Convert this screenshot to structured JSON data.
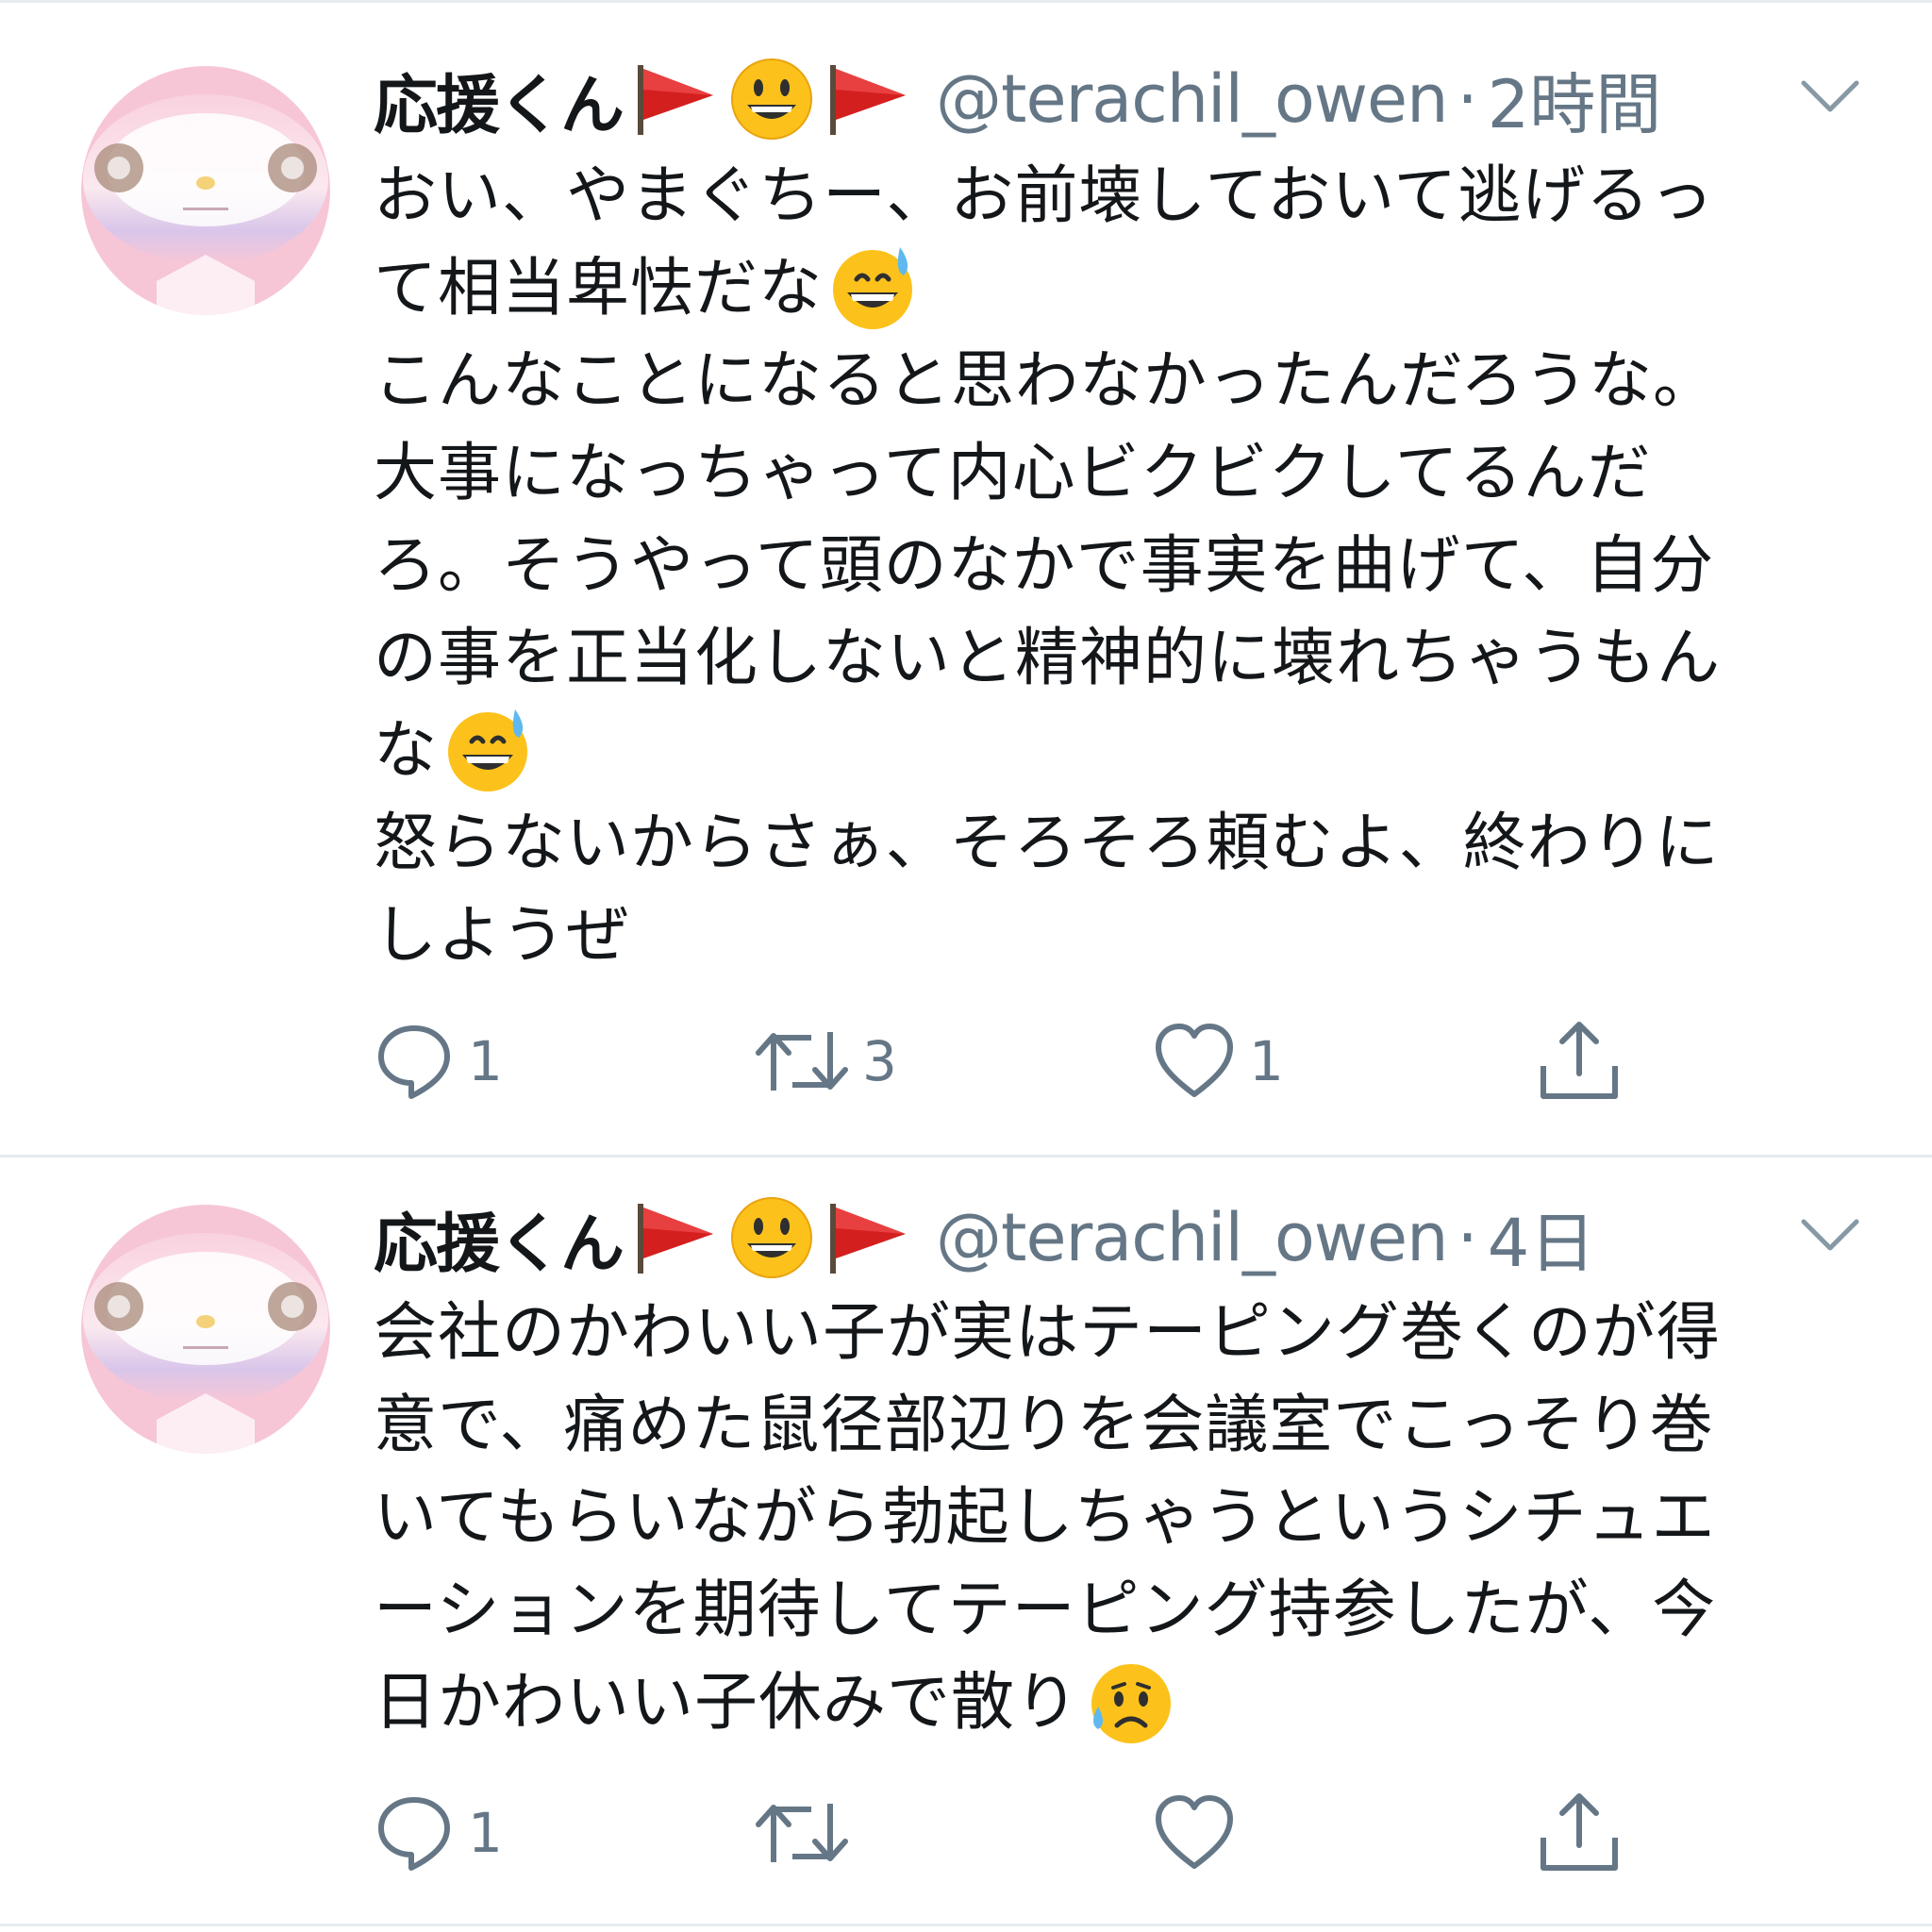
{
  "tweets": [
    {
      "author": {
        "display_name": "応援くん",
        "name_emojis": [
          "red-flag-icon",
          "grinning-face-icon",
          "red-flag-icon"
        ],
        "handle": "@terachil_owen"
      },
      "separator": "·",
      "time": "2時間",
      "text_lines": [
        "おい、やまぐちー、お前壊しておいて逃げるっ",
        "て相当卑怯だな",
        "こんなことになると思わなかったんだろうな。",
        "大事になっちゃって内心ビクビクしてるんだ",
        "ろ。そうやって頭のなかで事実を曲げて、自分",
        "の事を正当化しないと精神的に壊れちゃうもん",
        "な",
        "怒らないからさぁ、そろそろ頼むよ、終わりに",
        "しようぜ"
      ],
      "inline_emojis": {
        "line_1": "grinning-sweat-icon",
        "line_6": "grinning-sweat-icon"
      },
      "counts": {
        "reply": "1",
        "retweet": "3",
        "like": "1"
      }
    },
    {
      "author": {
        "display_name": "応援くん",
        "name_emojis": [
          "red-flag-icon",
          "grinning-face-icon",
          "red-flag-icon"
        ],
        "handle": "@terachil_owen"
      },
      "separator": "·",
      "time": "4日",
      "text_lines": [
        "会社のかわいい子が実はテーピング巻くのが得",
        "意で、痛めた鼠径部辺りを会議室でこっそり巻",
        "いてもらいながら勃起しちゃうというシチュエ",
        "ーションを期待してテーピング持参したが、今",
        "日かわいい子休みで散り"
      ],
      "inline_emojis": {
        "line_4": "sad-sweat-icon"
      },
      "counts": {
        "reply": "1",
        "retweet": "",
        "like": ""
      }
    }
  ],
  "colors": {
    "text": "#14171a",
    "secondary": "#657786",
    "divider": "#e6ecf0",
    "avatar_pink": "#f7c6d6"
  }
}
